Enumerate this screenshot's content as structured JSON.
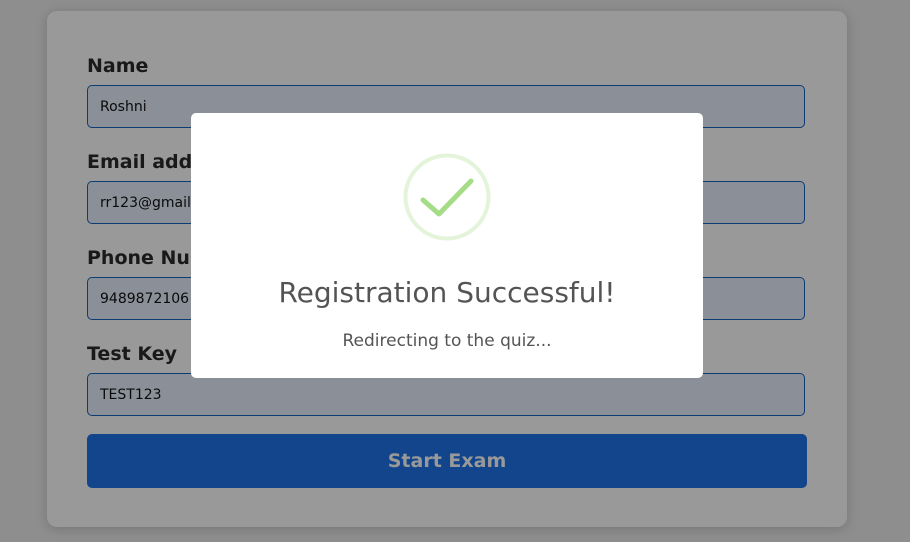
{
  "form": {
    "fields": [
      {
        "label": "Name",
        "value": "Roshni"
      },
      {
        "label": "Email address",
        "value": "rr123@gmail.com"
      },
      {
        "label": "Phone Number",
        "value": "9489872106"
      },
      {
        "label": "Test Key",
        "value": "TEST123"
      }
    ],
    "submit_label": "Start Exam"
  },
  "modal": {
    "icon": "checkmark-icon",
    "title": "Registration Successful!",
    "message": "Redirecting to the quiz..."
  },
  "colors": {
    "accent": "#1e73e8",
    "input_border": "#1565c0",
    "success": "#a5dc86",
    "modal_text": "#545454"
  }
}
